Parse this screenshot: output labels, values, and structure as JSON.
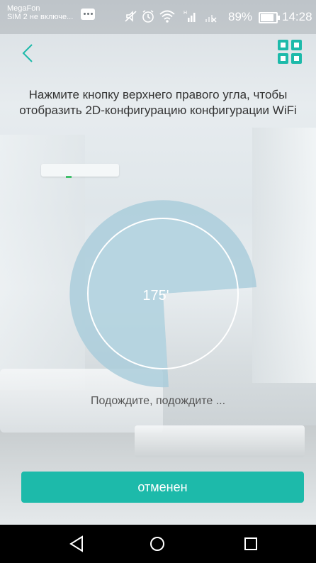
{
  "status_bar": {
    "carrier_line1": "MegaFon",
    "carrier_line2": "SIM 2 не включе...",
    "icons": [
      "mute-icon",
      "alarm-icon",
      "wifi-icon",
      "signal-icon",
      "no-signal-icon"
    ],
    "battery": "89%",
    "time": "14:28"
  },
  "header": {
    "back_icon": "chevron-left-icon",
    "qr_icon": "qr-code-icon",
    "accent_color": "#1dbaaa"
  },
  "instruction": "Нажмите кнопку верхнего правого угла, чтобы отобразить 2D-конфигурацию конфигурации WiFi",
  "scanner": {
    "angle": "175'",
    "status_text": "Подождите, подождите ..."
  },
  "cancel_button": {
    "label": "отменен"
  },
  "navbar": {
    "back_icon": "triangle-back-icon",
    "home_icon": "circle-home-icon",
    "recents_icon": "square-recents-icon"
  }
}
